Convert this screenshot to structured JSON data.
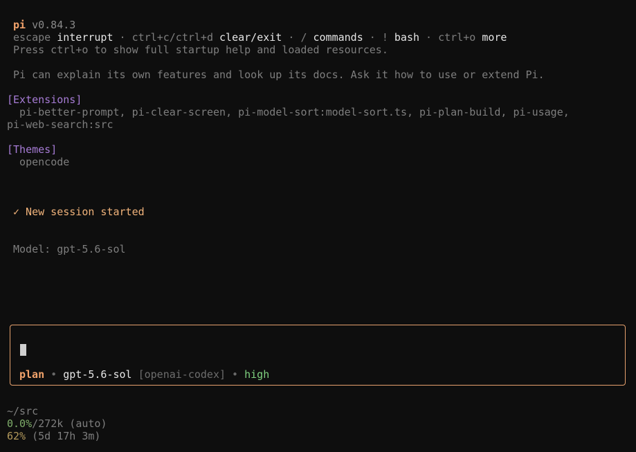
{
  "header": {
    "app_name": "pi",
    "version": "v0.84.3",
    "shortcuts": [
      {
        "key": "escape",
        "action": "interrupt"
      },
      {
        "key": "ctrl+c/ctrl+d",
        "action": "clear/exit"
      },
      {
        "key": "/",
        "action": "commands"
      },
      {
        "key": "!",
        "action": "bash"
      },
      {
        "key": "ctrl+o",
        "action": "more"
      }
    ],
    "separator": " · ",
    "help_hint": "Press ctrl+o to show full startup help and loaded resources.",
    "intro": "Pi can explain its own features and look up its docs. Ask it how to use or extend Pi."
  },
  "extensions": {
    "heading": "[Extensions]",
    "line1": "  pi-better-prompt, pi-clear-screen, pi-model-sort:model-sort.ts, pi-plan-build, pi-usage,",
    "line2": "pi-web-search:src"
  },
  "themes": {
    "heading": "[Themes]",
    "value": "  opencode"
  },
  "session": {
    "message": "✓ New session started",
    "model_line": "Model: gpt-5.6-sol"
  },
  "editor": {
    "input_value": "",
    "mode": "plan",
    "bullet": " • ",
    "model": "gpt-5.6-sol",
    "provider": "[openai-codex]",
    "thinking": "high",
    "colors": {
      "border": "#e7a26e",
      "mode": "#f2a36b",
      "thinking": "#7fd17f"
    }
  },
  "footer": {
    "cwd": "~/src",
    "context_percent": "0.0%",
    "context_rest": "/272k (auto)",
    "usage_percent": "62%",
    "usage_rest": " (5d 17h 3m)"
  }
}
